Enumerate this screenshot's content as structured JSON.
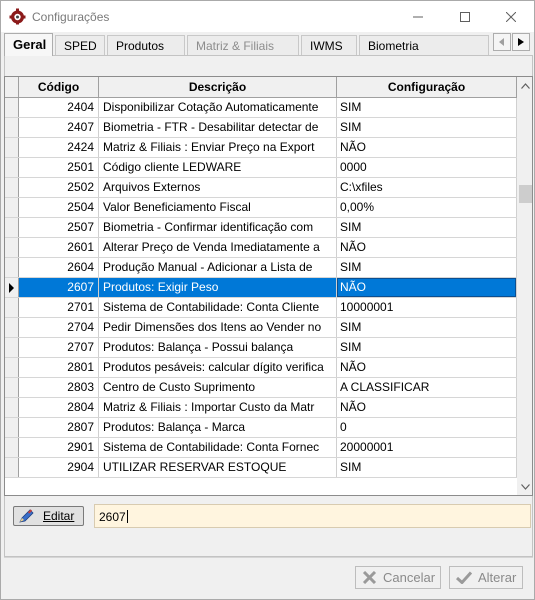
{
  "window": {
    "title": "Configurações",
    "icons": {
      "app": "gear-app-icon",
      "minimize": "minimize-icon",
      "maximize": "maximize-icon",
      "close": "close-icon"
    }
  },
  "tabs": [
    {
      "label": "Geral",
      "state": "active"
    },
    {
      "label": "SPED",
      "state": "normal"
    },
    {
      "label": "Produtos",
      "state": "normal"
    },
    {
      "label": "Matriz & Filiais",
      "state": "disabled"
    },
    {
      "label": "IWMS",
      "state": "normal"
    },
    {
      "label": "Biometria",
      "state": "normal"
    }
  ],
  "grid": {
    "columns": [
      "Código",
      "Descrição",
      "Configuração"
    ],
    "selected_code": "2607",
    "rows": [
      {
        "code": "2404",
        "desc": "Disponibilizar Cotação Automaticamente",
        "value": "SIM"
      },
      {
        "code": "2407",
        "desc": "Biometria - FTR - Desabilitar detectar de",
        "value": "SIM"
      },
      {
        "code": "2424",
        "desc": "Matriz & Filiais : Enviar Preço na Export",
        "value": "NÃO"
      },
      {
        "code": "2501",
        "desc": "Código cliente LEDWARE",
        "value": "0000"
      },
      {
        "code": "2502",
        "desc": "Arquivos Externos",
        "value": "C:\\xfiles"
      },
      {
        "code": "2504",
        "desc": "Valor Beneficiamento Fiscal",
        "value": "0,00%"
      },
      {
        "code": "2507",
        "desc": "Biometria - Confirmar identificação com",
        "value": "SIM"
      },
      {
        "code": "2601",
        "desc": "Alterar Preço de Venda Imediatamente a",
        "value": "NÃO"
      },
      {
        "code": "2604",
        "desc": "Produção Manual - Adicionar a Lista de",
        "value": "SIM"
      },
      {
        "code": "2607",
        "desc": "Produtos: Exigir Peso",
        "value": "NÃO"
      },
      {
        "code": "2701",
        "desc": "Sistema de Contabilidade: Conta Cliente",
        "value": "10000001"
      },
      {
        "code": "2704",
        "desc": "Pedir Dimensões dos Itens ao Vender no",
        "value": "SIM"
      },
      {
        "code": "2707",
        "desc": "Produtos: Balança - Possui balança",
        "value": "SIM"
      },
      {
        "code": "2801",
        "desc": "Produtos pesáveis: calcular dígito verifica",
        "value": "NÃO"
      },
      {
        "code": "2803",
        "desc": "Centro de Custo Suprimento",
        "value": "A CLASSIFICAR"
      },
      {
        "code": "2804",
        "desc": "Matriz & Filiais : Importar Custo da Matr",
        "value": "NÃO"
      },
      {
        "code": "2807",
        "desc": "Produtos: Balança - Marca",
        "value": "0"
      },
      {
        "code": "2901",
        "desc": "Sistema de Contabilidade: Conta Fornec",
        "value": "20000001"
      },
      {
        "code": "2904",
        "desc": "UTILIZAR RESERVAR ESTOQUE",
        "value": "SIM"
      }
    ]
  },
  "edit": {
    "button_label": "Editar",
    "button_icon": "pencil-icon",
    "field_value": "2607"
  },
  "footer": {
    "cancel_label": "Cancelar",
    "cancel_icon": "x-icon",
    "ok_label": "Alterar",
    "ok_icon": "checkmark-icon"
  },
  "colors": {
    "selection": "#0078d7",
    "edit_field_bg": "#fff5df"
  }
}
